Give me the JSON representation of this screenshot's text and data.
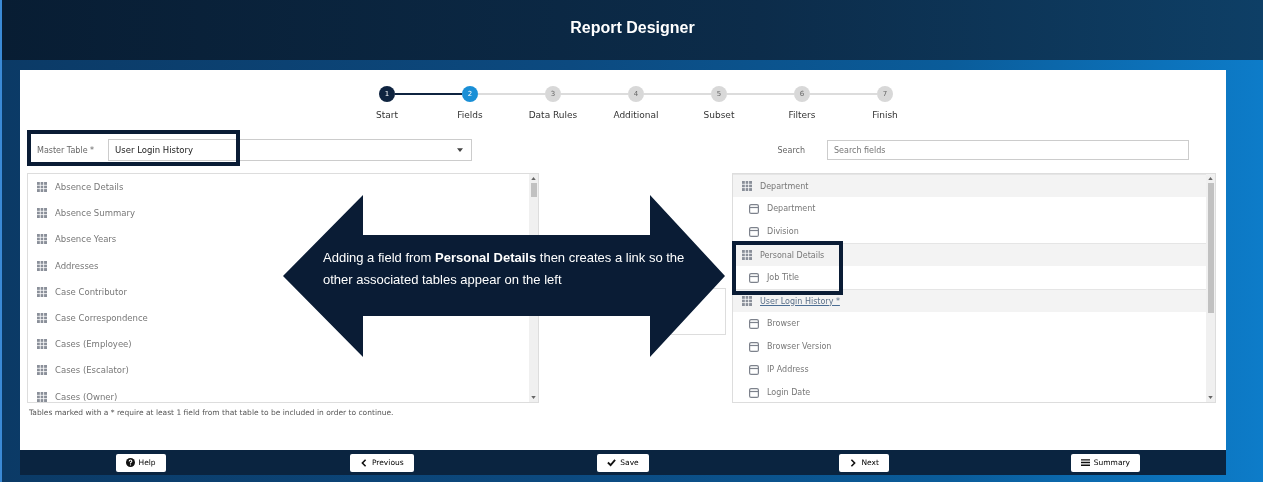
{
  "header": {
    "title": "Report Designer"
  },
  "steps": [
    {
      "number": "1",
      "label": "Start",
      "completed": true,
      "selected": false
    },
    {
      "number": "2",
      "label": "Fields",
      "completed": false,
      "selected": true
    },
    {
      "number": "3",
      "label": "Data Rules",
      "completed": false,
      "selected": false
    },
    {
      "number": "4",
      "label": "Additional",
      "completed": false,
      "selected": false
    },
    {
      "number": "5",
      "label": "Subset",
      "completed": false,
      "selected": false
    },
    {
      "number": "6",
      "label": "Filters",
      "completed": false,
      "selected": false
    },
    {
      "number": "7",
      "label": "Finish",
      "completed": false,
      "selected": false
    }
  ],
  "master_table": {
    "label": "Master Table *",
    "value": "User Login History"
  },
  "search": {
    "label": "Search",
    "placeholder": "Search fields"
  },
  "tables": [
    "Absence Details",
    "Absence Summary",
    "Absence Years",
    "Addresses",
    "Case Contributor",
    "Case Correspondence",
    "Cases (Employee)",
    "Cases (Escalator)",
    "Cases (Owner)"
  ],
  "note": "Tables marked with a * require at least 1 field from that table to be included in order to continue.",
  "selected_fields": [
    {
      "kind": "group",
      "label": "Department",
      "underlined": false
    },
    {
      "kind": "field",
      "label": "Department"
    },
    {
      "kind": "field",
      "label": "Division"
    },
    {
      "kind": "group",
      "label": "Personal Details",
      "underlined": false
    },
    {
      "kind": "field",
      "label": "Job Title"
    },
    {
      "kind": "group",
      "label": "User Login History *",
      "underlined": true
    },
    {
      "kind": "field",
      "label": "Browser"
    },
    {
      "kind": "field",
      "label": "Browser Version"
    },
    {
      "kind": "field",
      "label": "IP Address"
    },
    {
      "kind": "field",
      "label": "Login Date"
    }
  ],
  "callout": {
    "text": "Adding a field from **Personal Details** then creates a link so the other associated tables appear on the left"
  },
  "buttons": [
    {
      "kind": "help",
      "label": "Help"
    },
    {
      "kind": "previous",
      "label": "Previous"
    },
    {
      "kind": "save",
      "label": "Save"
    },
    {
      "kind": "next",
      "label": "Next"
    },
    {
      "kind": "summary",
      "label": "Summary"
    }
  ]
}
